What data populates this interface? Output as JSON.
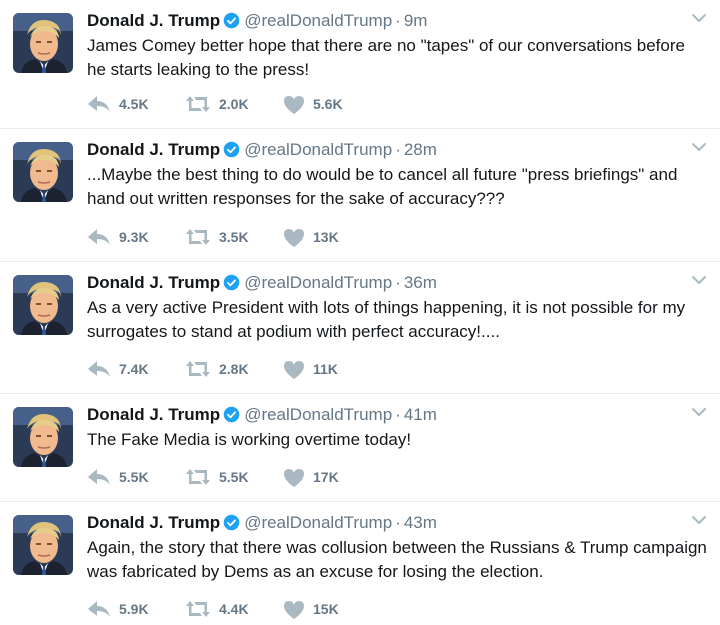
{
  "colors": {
    "text": "#14171a",
    "muted": "#657786",
    "icon": "#aab8c2",
    "verified": "#1da1f2",
    "divider": "#e6ecf0"
  },
  "icons": {
    "reply": "reply-icon",
    "retweet": "retweet-icon",
    "like": "heart-icon",
    "verified": "verified-badge-icon",
    "more": "chevron-down-icon"
  },
  "tweets": [
    {
      "name": "Donald J. Trump",
      "handle": "@realDonaldTrump",
      "separator": "·",
      "time": "9m",
      "text": "James Comey better hope that there are no \"tapes\" of our conversations before he starts leaking to the press!",
      "replies": "4.5K",
      "retweets": "2.0K",
      "likes": "5.6K"
    },
    {
      "name": "Donald J. Trump",
      "handle": "@realDonaldTrump",
      "separator": "·",
      "time": "28m",
      "text": "...Maybe the best thing to do would be to cancel all future \"press briefings\" and hand out written responses for the sake of accuracy???",
      "replies": "9.3K",
      "retweets": "3.5K",
      "likes": "13K"
    },
    {
      "name": "Donald J. Trump",
      "handle": "@realDonaldTrump",
      "separator": "·",
      "time": "36m",
      "text": "As a very active President with lots of things happening, it is not possible for my surrogates to stand at podium with perfect accuracy!....",
      "replies": "7.4K",
      "retweets": "2.8K",
      "likes": "11K"
    },
    {
      "name": "Donald J. Trump",
      "handle": "@realDonaldTrump",
      "separator": "·",
      "time": "41m",
      "text": "The Fake Media is working overtime today!",
      "replies": "5.5K",
      "retweets": "5.5K",
      "likes": "17K"
    },
    {
      "name": "Donald J. Trump",
      "handle": "@realDonaldTrump",
      "separator": "·",
      "time": "43m",
      "text": "Again, the story that there was collusion between the Russians & Trump campaign was fabricated by Dems as an excuse for losing the election.",
      "replies": "5.9K",
      "retweets": "4.4K",
      "likes": "15K"
    }
  ]
}
